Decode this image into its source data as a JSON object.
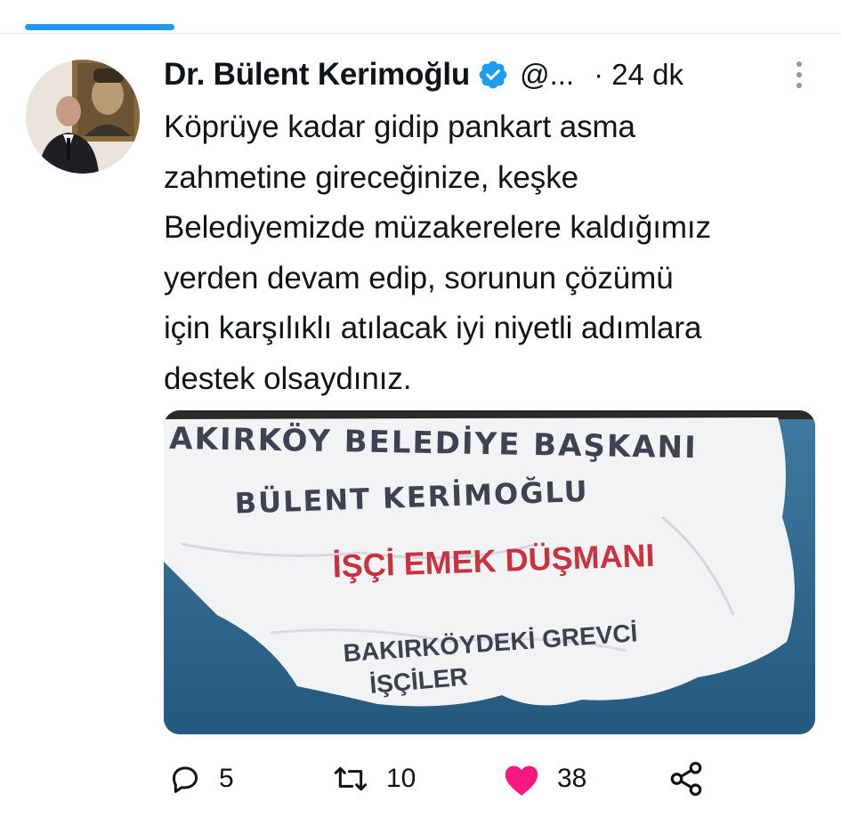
{
  "tweet": {
    "display_name": "Dr. Bülent Kerimoğlu",
    "handle": "@...",
    "timestamp": "· 24 dk",
    "text": "Köprüye kadar gidip pankart asma\nzahmetine gireceğinize, keşke\nBelediyemizde müzakerelere kaldığımız\nyerden devam edip, sorunun çözümü\niçin karşılıklı atılacak iyi niyetli adımlara\ndestek olsaydınız.",
    "media": {
      "banner_line1": "AKIRKÖY BELEDİYE BAŞKANI",
      "banner_line2": "BÜLENT KERİMOĞLU",
      "banner_line3": "İŞÇİ EMEK DÜŞMANI",
      "banner_line4": "BAKIRKÖYDEKİ GREVCİ",
      "banner_line5": "İŞÇİLER"
    }
  },
  "actions": {
    "reply_count": "5",
    "retweet_count": "10",
    "like_count": "38"
  },
  "colors": {
    "accent": "#1d9bf0",
    "like": "#f91880",
    "banner_red": "#c8333f",
    "banner_text": "#3b4150"
  },
  "icons": [
    "verified-badge-icon",
    "more-vertical-icon",
    "reply-icon",
    "retweet-icon",
    "heart-icon",
    "share-icon"
  ]
}
